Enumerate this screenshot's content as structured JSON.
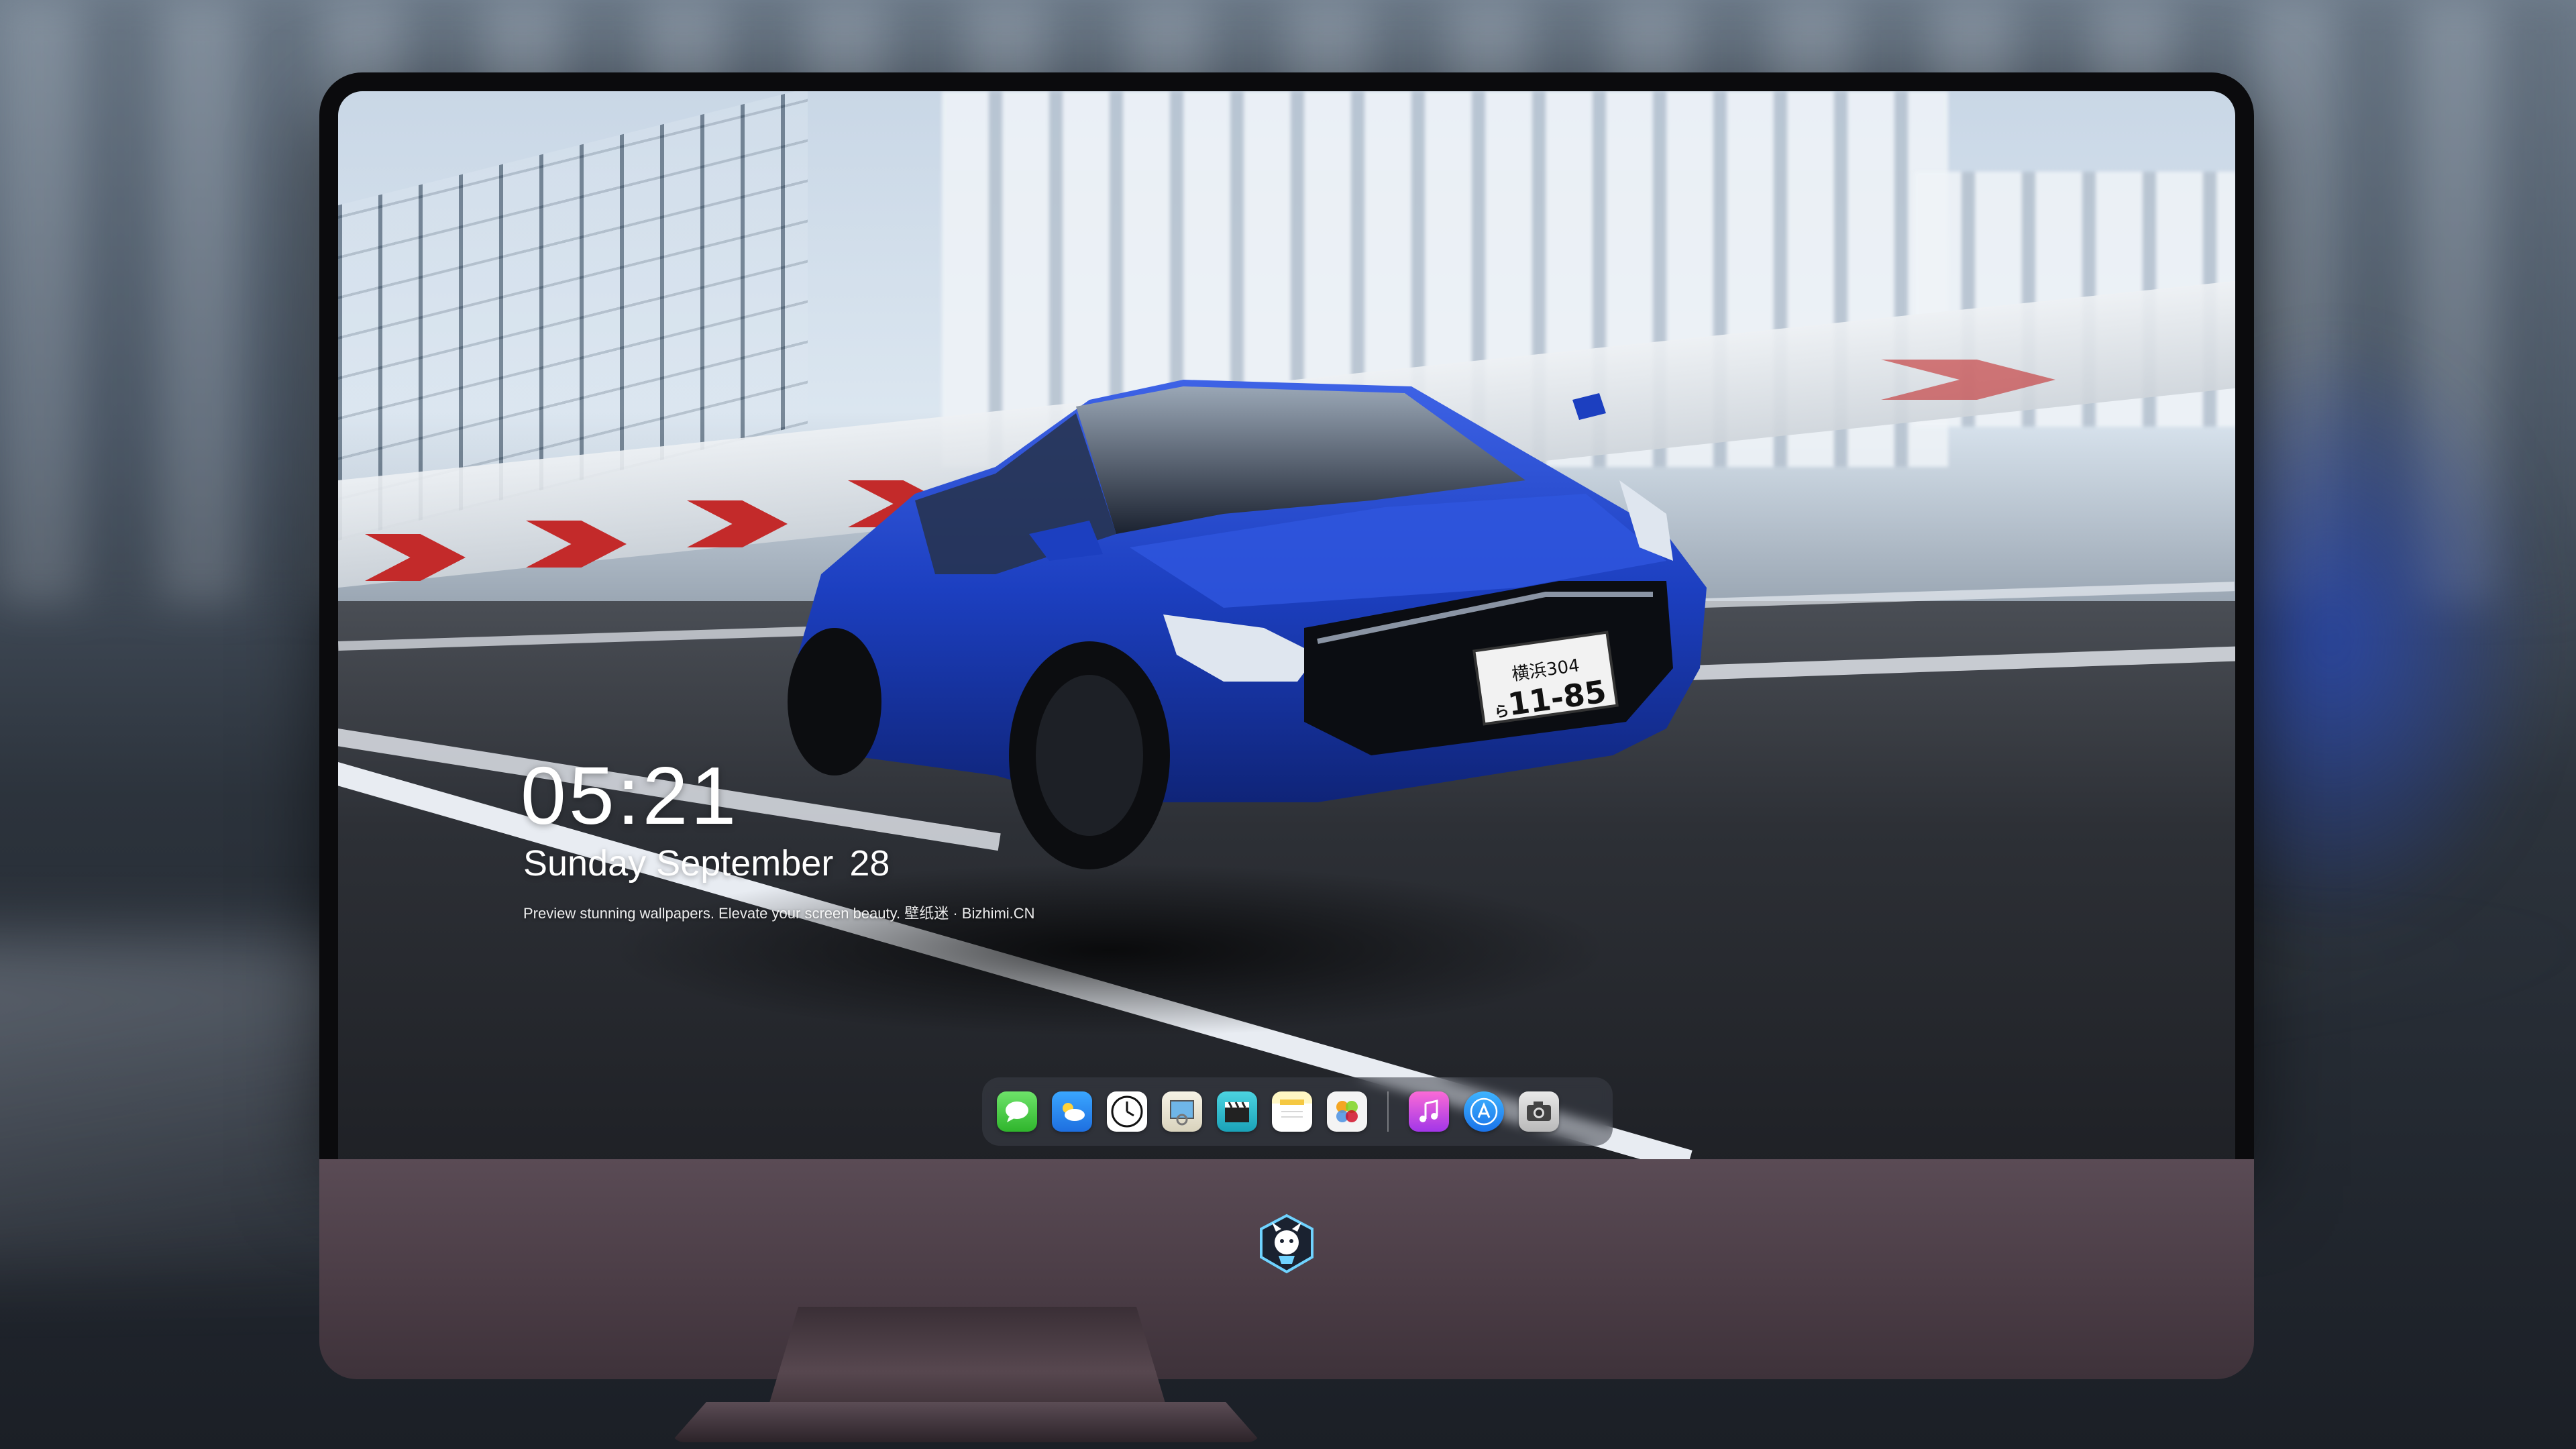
{
  "lockscreen": {
    "time": "05:21",
    "day": "Sunday",
    "month": "September",
    "date": "28",
    "caption": "Preview stunning wallpapers. Elevate your screen beauty. 壁纸迷 · Bizhimi.CN"
  },
  "wallpaper": {
    "plate_top": "横浜304",
    "plate_prefix": "ら",
    "plate_number": "11-85"
  },
  "dock": {
    "apps": [
      "messages-icon",
      "weather-icon",
      "clock-icon",
      "preview-icon",
      "clapper-icon",
      "notes-icon",
      "photos-icon",
      "music-icon",
      "app-store-icon",
      "camera-icon"
    ]
  },
  "colors": {
    "chin": "#4a3c45",
    "car_blue": "#1c3fc0",
    "bezel": "#0b0b0d"
  }
}
